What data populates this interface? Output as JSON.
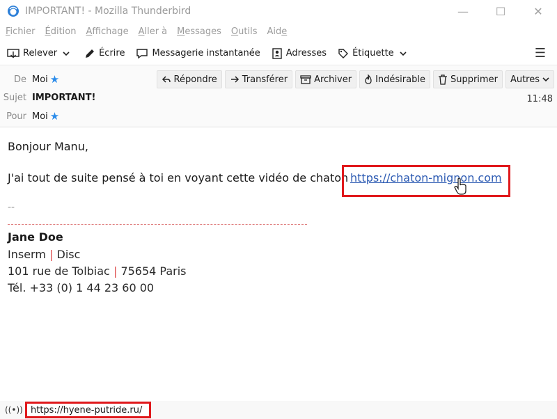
{
  "window": {
    "title": "IMPORTANT! - Mozilla Thunderbird",
    "minimize": "—",
    "maximize": "☐",
    "close": "✕"
  },
  "menubar": {
    "items": [
      {
        "pre": "",
        "ul": "F",
        "post": "ichier"
      },
      {
        "pre": "",
        "ul": "É",
        "post": "dition"
      },
      {
        "pre": "",
        "ul": "A",
        "post": "ffichage"
      },
      {
        "pre": "",
        "ul": "A",
        "post": "ller à"
      },
      {
        "pre": "",
        "ul": "M",
        "post": "essages"
      },
      {
        "pre": "",
        "ul": "O",
        "post": "utils"
      },
      {
        "pre": "Aid",
        "ul": "e",
        "post": ""
      }
    ]
  },
  "toolbar": {
    "relever": "Relever",
    "ecrire": "Écrire",
    "messagerie": "Messagerie instantanée",
    "adresses": "Adresses",
    "etiquette": "Étiquette",
    "menu": "☰"
  },
  "header": {
    "from_label": "De",
    "from_value": "Moi",
    "subject_label": "Sujet",
    "subject_value": "IMPORTANT!",
    "to_label": "Pour",
    "to_value": "Moi",
    "time": "11:48",
    "buttons": {
      "reply": "Répondre",
      "forward": "Transférer",
      "archive": "Archiver",
      "junk": "Indésirable",
      "delete": "Supprimer",
      "other": "Autres"
    }
  },
  "body": {
    "greeting": "Bonjour Manu,",
    "text": "J'ai tout de suite pensé à toi en voyant cette vidéo de chaton",
    "link": "https://chaton-mignon.com",
    "sig_dash": "--",
    "sig_name": "Jane Doe",
    "sig_org1": "Inserm",
    "sig_org2": "Disc",
    "sig_street": "101 rue de Tolbiac",
    "sig_city": "75654 Paris",
    "sig_phone": "Tél. +33 (0) 1 44 23 60 00",
    "sig_sep": "|"
  },
  "status": {
    "url": "https://hyene-putride.ru/"
  },
  "colors": {
    "highlight": "#e0191c",
    "link": "#2d5bb3",
    "star": "#2a8bea"
  }
}
